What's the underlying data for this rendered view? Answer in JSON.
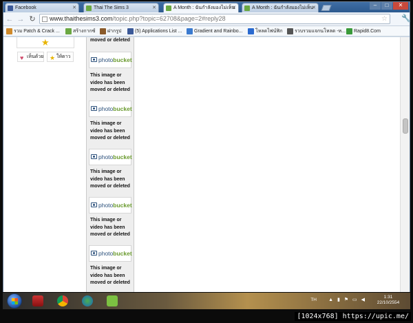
{
  "tabs": [
    {
      "label": "Facebook",
      "color": "#3b5998",
      "active": false
    },
    {
      "label": "Thai The Sims 3",
      "color": "#6aa842",
      "active": false
    },
    {
      "label": "A Month : ฉันกำลังมองไม่เห็น",
      "color": "#6aa842",
      "active": true
    },
    {
      "label": "A Month : ฉันกำลังมองไม่เห็น",
      "color": "#6aa842",
      "active": false
    }
  ],
  "address": {
    "host": "www.thaithesims3.com",
    "path": "/topic.php?topic=62708&page=2#reply28"
  },
  "bookmarks": [
    {
      "label": "รวม Patch & Crack ...",
      "color": "#d08a2a"
    },
    {
      "label": "สร้างกากซ์",
      "color": "#6aa842"
    },
    {
      "label": "ฝากรูป",
      "color": "#8a5a2a"
    },
    {
      "label": "(5) Applications List ...",
      "color": "#3b5998"
    },
    {
      "label": "Gradient and Rainbo...",
      "color": "#3a7acf"
    },
    {
      "label": "โหลดไฟน์ฟิก",
      "color": "#2a6acf"
    },
    {
      "label": "รวบรวมแจกนโหลด -ห...",
      "color": "#555"
    },
    {
      "label": "Rapid8.Com",
      "color": "#3a9a3a"
    }
  ],
  "reactions": {
    "like": "เห็นด้วย",
    "star": "ให้ดาว"
  },
  "photobucket": {
    "message": [
      "This image or",
      "video has been",
      "moved or deleted"
    ],
    "logo_a": "photo",
    "logo_b": "bucket"
  },
  "taskbar": {
    "lang": "TH",
    "time": "1:31",
    "date": "22/10/2554"
  },
  "watermark": "[1024x768] https://upic.me/"
}
